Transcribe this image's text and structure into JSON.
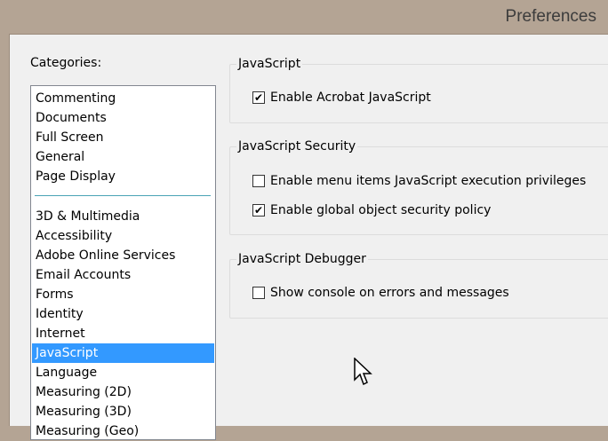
{
  "window": {
    "title": "Preferences"
  },
  "categories": {
    "label": "Categories:",
    "top": [
      "Commenting",
      "Documents",
      "Full Screen",
      "General",
      "Page Display"
    ],
    "rest": [
      "3D & Multimedia",
      "Accessibility",
      "Adobe Online Services",
      "Email Accounts",
      "Forms",
      "Identity",
      "Internet",
      "JavaScript",
      "Language",
      "Measuring (2D)",
      "Measuring (3D)",
      "Measuring (Geo)"
    ],
    "selected": "JavaScript"
  },
  "groups": [
    {
      "title": "JavaScript",
      "options": [
        {
          "label": "Enable Acrobat JavaScript",
          "checked": true
        }
      ]
    },
    {
      "title": "JavaScript Security",
      "options": [
        {
          "label": "Enable menu items JavaScript execution privileges",
          "checked": false
        },
        {
          "label": "Enable global object security policy",
          "checked": true
        }
      ]
    },
    {
      "title": "JavaScript Debugger",
      "options": [
        {
          "label": "Show console on errors and messages",
          "checked": false
        }
      ]
    }
  ]
}
